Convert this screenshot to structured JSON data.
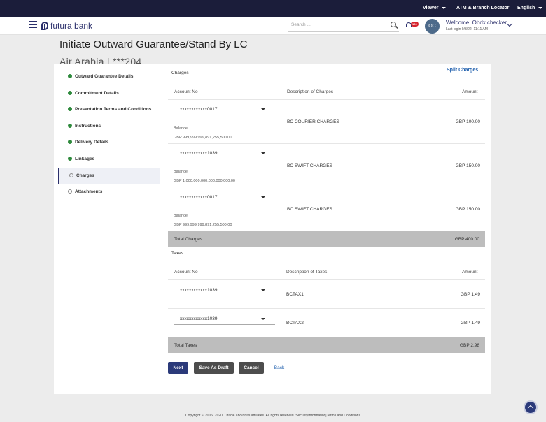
{
  "topbar": {
    "viewer": "Viewer",
    "atm_locator": "ATM & Branch Locator",
    "language": "English"
  },
  "header": {
    "brand": "futura bank",
    "search_placeholder": "Search ...",
    "notification_badge": "100",
    "avatar_initials": "OC",
    "welcome": "Welcome, Obdx checker",
    "last_login": "Last login 9/3/22, 11:11 AM"
  },
  "page": {
    "title": "Initiate Outward Guarantee/Stand By LC",
    "subtitle": "Air Arabia | ***204"
  },
  "side_nav": [
    {
      "label": "Outward Guarantee Details",
      "state": "done"
    },
    {
      "label": "Commitment Details",
      "state": "done"
    },
    {
      "label": "Presentation Terms and Conditions",
      "state": "done"
    },
    {
      "label": "Instructions",
      "state": "done"
    },
    {
      "label": "Delivery Details",
      "state": "done"
    },
    {
      "label": "Linkages",
      "state": "done"
    },
    {
      "label": "Charges",
      "state": "active"
    },
    {
      "label": "Attachments",
      "state": "pending"
    }
  ],
  "charges": {
    "section_title": "Charges",
    "split_link": "Split Charges",
    "headers": {
      "account": "Account No",
      "description": "Description of Charges",
      "amount": "Amount"
    },
    "balance_label": "Balance",
    "rows": [
      {
        "account": "xxxxxxxxxxxx0017",
        "balance": "GBP 999,999,999,891,255,500.00",
        "description": "BC COURIER CHARGES",
        "amount": "GBP 100.00"
      },
      {
        "account": "xxxxxxxxxxxx1039",
        "balance": "GBP 1,000,000,000,000,000,000.00",
        "description": "BC SWIFT CHARGES",
        "amount": "GBP 150.00"
      },
      {
        "account": "xxxxxxxxxxxx0017",
        "balance": "GBP 999,999,999,891,255,500.00",
        "description": "BC SWIFT CHARGES",
        "amount": "GBP 150.00"
      }
    ],
    "total_label": "Total Charges",
    "total_value": "GBP 400.00"
  },
  "taxes": {
    "section_title": "Taxes",
    "headers": {
      "account": "Account No",
      "description": "Description of Taxes",
      "amount": "Amount"
    },
    "rows": [
      {
        "account": "xxxxxxxxxxxx1039",
        "description": "BCTAX1",
        "amount": "GBP 1.49"
      },
      {
        "account": "xxxxxxxxxxxx1039",
        "description": "BCTAX2",
        "amount": "GBP 1.49"
      }
    ],
    "total_label": "Total Taxes",
    "total_value": "GBP 2.98"
  },
  "buttons": {
    "next": "Next",
    "save_draft": "Save As Draft",
    "cancel": "Cancel",
    "back": "Back"
  },
  "footer": "Copyright © 2006, 2020, Oracle and/or its affiliates. All rights reserved.|SecurityInformation|Terms and Conditions"
}
